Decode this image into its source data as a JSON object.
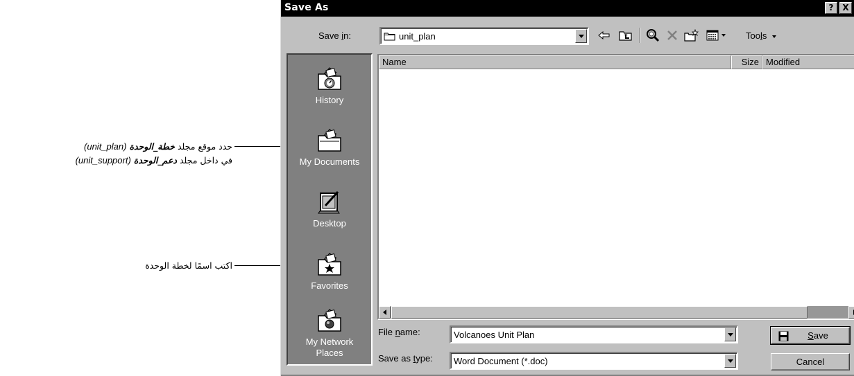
{
  "callouts": {
    "folder_location": {
      "line1_prefix": "حدد موقع مجلد",
      "line1_bold": "خطة_الوحدة",
      "line1_paren": "(unit_plan)",
      "line2_prefix": "في داخل مجلد",
      "line2_bold": "دعم_الوحدة",
      "line2_paren": "(unit_support)"
    },
    "type_name": {
      "text": "اكتب اسمًا لخطة الوحدة"
    }
  },
  "dialog": {
    "title": "Save As",
    "help_glyph": "?",
    "close_glyph": "X",
    "save_in": {
      "label_pre": "Save ",
      "label_u": "i",
      "label_post": "n:",
      "value": "unit_plan"
    },
    "toolbar": {
      "tools_pre": "Too",
      "tools_u": "l",
      "tools_post": "s"
    },
    "places": [
      {
        "label": "History",
        "icon": "history-icon"
      },
      {
        "label": "My Documents",
        "icon": "my-documents-icon"
      },
      {
        "label": "Desktop",
        "icon": "desktop-icon"
      },
      {
        "label": "Favorites",
        "icon": "favorites-icon"
      },
      {
        "label": "My Network Places",
        "icon": "network-places-icon"
      }
    ],
    "columns": {
      "name": "Name",
      "size": "Size",
      "modified": "Modified"
    },
    "file_name": {
      "label_pre": "File ",
      "label_u": "n",
      "label_post": "ame:",
      "value": "Volcanoes Unit Plan"
    },
    "save_as_type": {
      "label_pre": "Save as ",
      "label_u": "t",
      "label_post": "ype:",
      "value": "Word Document (*.doc)"
    },
    "buttons": {
      "save_u": "S",
      "save_post": "ave",
      "cancel": "Cancel"
    }
  }
}
